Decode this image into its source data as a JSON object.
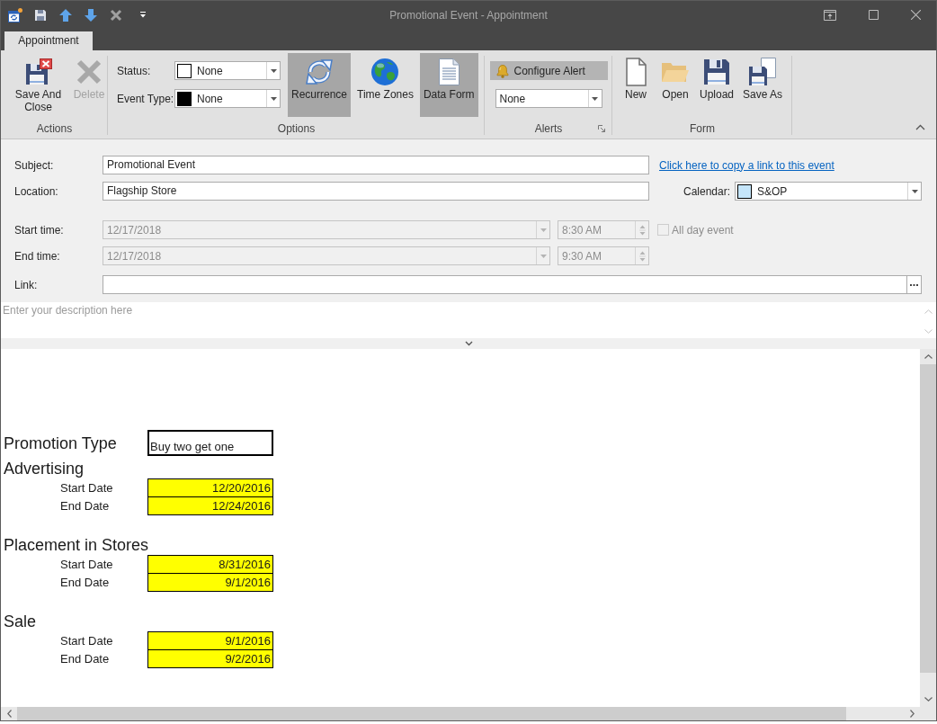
{
  "window": {
    "title": "Promotional Event - Appointment"
  },
  "tabs": [
    {
      "label": "Appointment",
      "selected": true
    }
  ],
  "ribbon": {
    "groups": [
      {
        "label": "Actions",
        "dialog_launcher": false,
        "items": [
          {
            "kind": "large",
            "label": "Save And Close",
            "disabled": false
          },
          {
            "kind": "large",
            "label": "Delete",
            "disabled": true
          }
        ]
      },
      {
        "label": "Options",
        "dialog_launcher": false,
        "items": [
          {
            "kind": "stack",
            "rows": [
              {
                "kind": "dropdown",
                "label": "Status:",
                "value": "None",
                "color": "#ffffff"
              },
              {
                "kind": "dropdown",
                "label": "Event Type:",
                "value": "None",
                "color": "#000000"
              }
            ]
          },
          {
            "kind": "large",
            "label": "Recurrence",
            "pressed": true
          },
          {
            "kind": "large",
            "label": "Time Zones",
            "pressed": false
          },
          {
            "kind": "large",
            "label": "Data Form",
            "pressed": true
          }
        ]
      },
      {
        "label": "Alerts",
        "dialog_launcher": true,
        "items": [
          {
            "kind": "stack",
            "rows": [
              {
                "kind": "button",
                "label": "Configure Alert",
                "pressed": true
              },
              {
                "kind": "dropdown",
                "value": "None"
              }
            ]
          }
        ]
      },
      {
        "label": "Form",
        "dialog_launcher": false,
        "items": [
          {
            "kind": "large",
            "label": "New"
          },
          {
            "kind": "large",
            "label": "Open"
          },
          {
            "kind": "large",
            "label": "Upload"
          },
          {
            "kind": "large",
            "label": "Save As"
          }
        ]
      }
    ]
  },
  "form": {
    "subject": {
      "label": "Subject:",
      "value": "Promotional Event"
    },
    "copy_link": "Click here to copy a link to this event",
    "location": {
      "label": "Location:",
      "value": "Flagship Store"
    },
    "calendar": {
      "label": "Calendar:",
      "value": "S&OP",
      "color": "#c5e5fa"
    },
    "start_time": {
      "label": "Start time:",
      "date": "12/17/2018",
      "time": "8:30 AM",
      "disabled": true
    },
    "all_day": {
      "label": "All day event",
      "checked": false,
      "disabled": true
    },
    "end_time": {
      "label": "End time:",
      "date": "12/17/2018",
      "time": "9:30 AM",
      "disabled": true
    },
    "link": {
      "label": "Link:"
    },
    "description": {
      "placeholder": "Enter your description here"
    }
  },
  "document": {
    "promotion_type": {
      "label": "Promotion Type",
      "value": "Buy two get one"
    },
    "sections": [
      {
        "title": "Advertising",
        "rows": [
          {
            "label": "Start Date",
            "value": "12/20/2016"
          },
          {
            "label": "End Date",
            "value": "12/24/2016"
          }
        ]
      },
      {
        "title": "Placement in Stores",
        "rows": [
          {
            "label": "Start Date",
            "value": "8/31/2016"
          },
          {
            "label": "End Date",
            "value": "9/1/2016"
          }
        ]
      },
      {
        "title": "Sale",
        "rows": [
          {
            "label": "Start Date",
            "value": "9/1/2016"
          },
          {
            "label": "End Date",
            "value": "9/2/2016"
          }
        ]
      }
    ]
  }
}
